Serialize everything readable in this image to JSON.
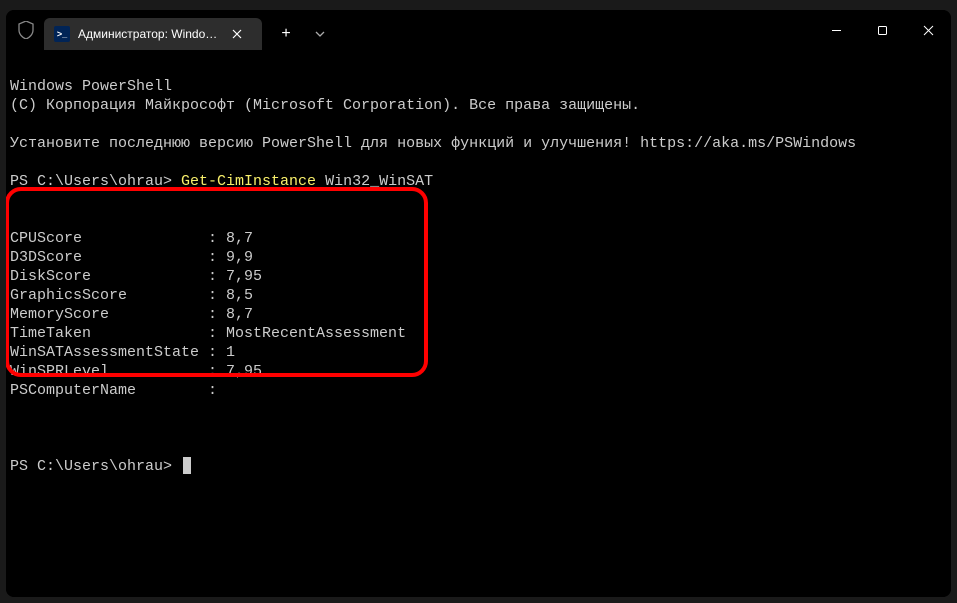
{
  "titlebar": {
    "tab_title": "Администратор: Windows Pc"
  },
  "term": {
    "line1": "Windows PowerShell",
    "line2": "(C) Корпорация Майкрософт (Microsoft Corporation). Все права защищены.",
    "line3": "Установите последнюю версию PowerShell для новых функций и улучшения! https://aka.ms/PSWindows",
    "prompt1_pre": "PS C:\\Users\\ohrau> ",
    "cmd": "Get-CimInstance",
    "cmd_arg": " Win32_WinSAT",
    "out1": "CPUScore              : 8,7",
    "out2": "D3DScore              : 9,9",
    "out3": "DiskScore             : 7,95",
    "out4": "GraphicsScore         : 8,5",
    "out5": "MemoryScore           : 8,7",
    "out6": "TimeTaken             : MostRecentAssessment",
    "out7": "WinSATAssessmentState : 1",
    "out8": "WinSPRLevel           : 7,95",
    "out9": "PSComputerName        :",
    "prompt2": "PS C:\\Users\\ohrau> "
  }
}
